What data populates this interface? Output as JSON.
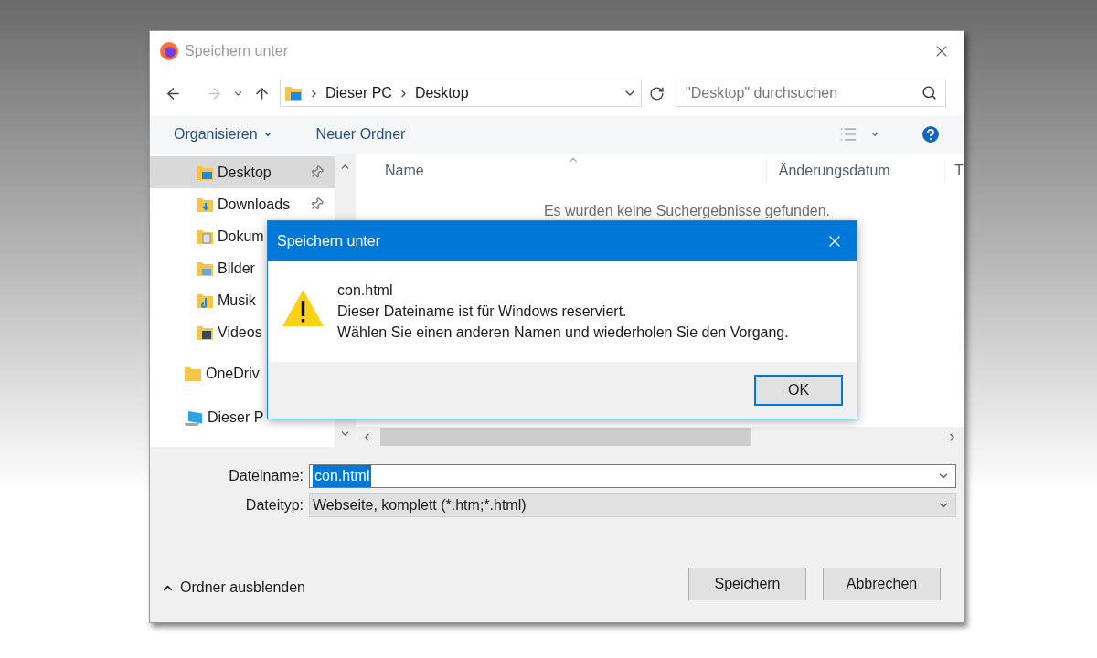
{
  "window": {
    "title": "Speichern unter"
  },
  "address": {
    "path": [
      "Dieser PC",
      "Desktop"
    ],
    "search": {
      "placeholder": "\"Desktop\" durchsuchen"
    }
  },
  "toolbar": {
    "organize": "Organisieren",
    "new_folder": "Neuer Ordner"
  },
  "sidebar": {
    "quick_access": [
      {
        "label": "Desktop",
        "kind": "desktop",
        "pinned": true,
        "selected": true
      },
      {
        "label": "Downloads",
        "kind": "downloads",
        "pinned": true,
        "selected": false
      },
      {
        "label": "Dokum",
        "kind": "documents",
        "selected": false
      },
      {
        "label": "Bilder",
        "kind": "pictures",
        "selected": false
      },
      {
        "label": "Musik",
        "kind": "music",
        "selected": false
      },
      {
        "label": "Videos",
        "kind": "videos",
        "selected": false
      }
    ],
    "locations": [
      {
        "label": "OneDriv",
        "kind": "onedrive",
        "selected": false
      },
      {
        "label": "Dieser P",
        "kind": "pc",
        "selected": false
      }
    ]
  },
  "file_list": {
    "columns": [
      "Name",
      "Änderungsdatum",
      "T"
    ],
    "empty_message": "Es wurden keine Suchergebnisse gefunden."
  },
  "form": {
    "filename_label": "Dateiname:",
    "filename": "con.html",
    "filetype_label": "Dateityp:",
    "filetype": "Webseite, komplett (*.htm;*.html)"
  },
  "footer": {
    "hide_folders": "Ordner ausblenden",
    "buttons": [
      "Speichern",
      "Abbrechen"
    ]
  },
  "alert": {
    "title": "Speichern unter",
    "filename": "con.html",
    "lines": [
      "Dieser Dateiname ist für Windows reserviert.",
      "Wählen Sie einen anderen Namen und wiederholen Sie den Vorgang."
    ],
    "button": "OK"
  }
}
